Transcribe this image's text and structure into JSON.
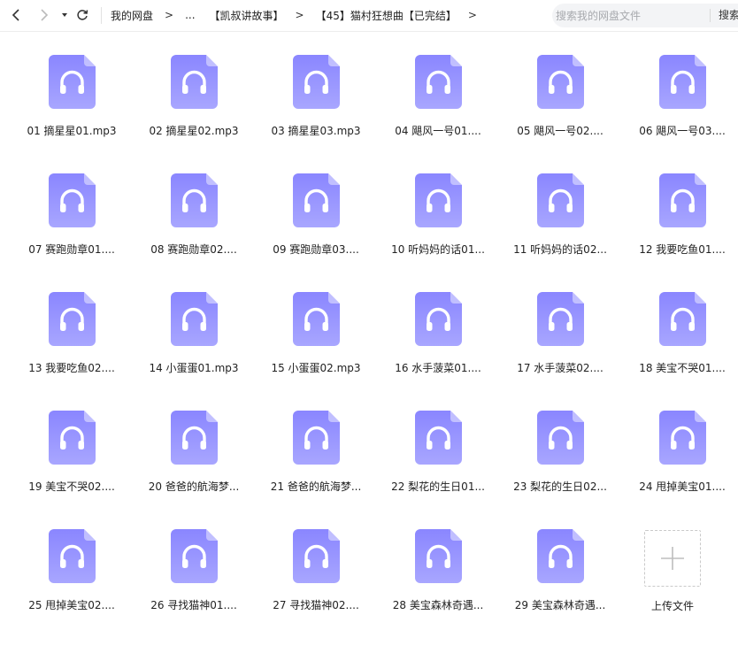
{
  "toolbar": {
    "back_icon": "chevron-left-icon",
    "forward_icon": "chevron-right-icon",
    "history_icon": "caret-down-icon",
    "refresh_icon": "refresh-icon"
  },
  "breadcrumb": {
    "items": [
      "我的网盘",
      "...",
      "【凯叔讲故事】",
      "【45】猫村狂想曲【已完结】"
    ],
    "separator": ">"
  },
  "search": {
    "placeholder": "搜索我的网盘文件",
    "button": "搜索"
  },
  "colors": {
    "icon_gradient_top": "#8a86ff",
    "icon_gradient_bottom": "#a8a6ff"
  },
  "files": [
    "01 摘星星01.mp3",
    "02 摘星星02.mp3",
    "03 摘星星03.mp3",
    "04 飓风一号01....",
    "05 飓风一号02....",
    "06 飓风一号03....",
    "07 赛跑勋章01....",
    "08 赛跑勋章02....",
    "09 赛跑勋章03....",
    "10 听妈妈的话01...",
    "11 听妈妈的话02...",
    "12 我要吃鱼01....",
    "13 我要吃鱼02....",
    "14 小蛋蛋01.mp3",
    "15 小蛋蛋02.mp3",
    "16 水手菠菜01....",
    "17 水手菠菜02....",
    "18 美宝不哭01....",
    "19 美宝不哭02....",
    "20 爸爸的航海梦...",
    "21 爸爸的航海梦...",
    "22 梨花的生日01...",
    "23 梨花的生日02...",
    "24 甩掉美宝01....",
    "25 甩掉美宝02....",
    "26 寻找猫神01....",
    "27 寻找猫神02....",
    "28 美宝森林奇遇...",
    "29 美宝森林奇遇..."
  ],
  "upload": {
    "label": "上传文件",
    "icon": "plus-icon"
  }
}
